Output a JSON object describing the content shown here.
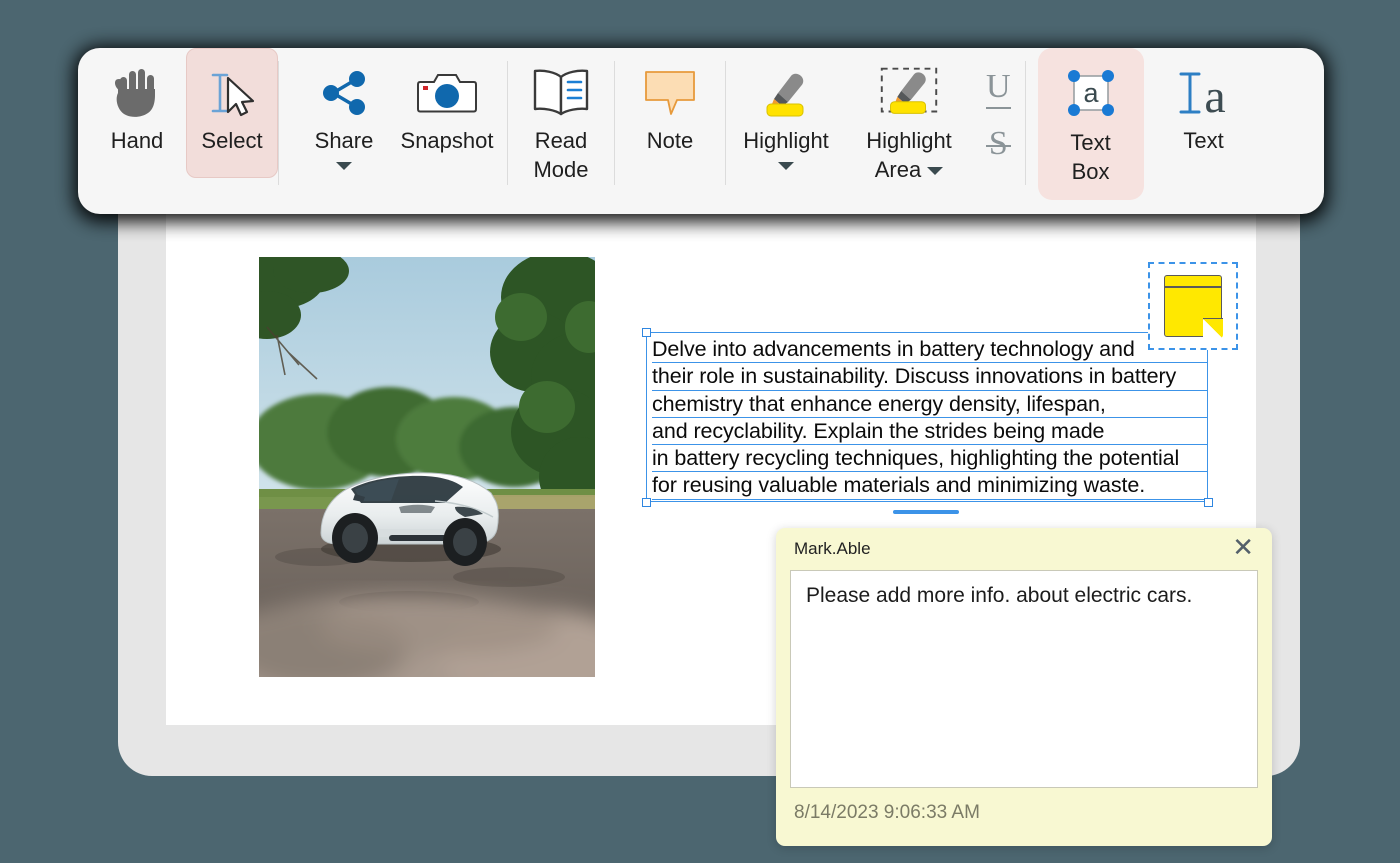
{
  "theme": {
    "background": "#4c6670",
    "window_frame": "#e6e6e6",
    "page": "#ffffff",
    "toolbar_bg": "#f6f6f6",
    "active_tool_bg": "#f2ddda",
    "accent_blue": "#3c93e8",
    "note_yellow": "#f8f8d2",
    "sticky_yellow": "#ffe800",
    "highlight_yellow": "#ffe200"
  },
  "toolbar": {
    "items": [
      {
        "id": "hand",
        "label": "Hand",
        "icon": "hand-icon",
        "active": false,
        "caret": false
      },
      {
        "id": "select",
        "label": "Select",
        "icon": "select-cursor-icon",
        "active": true,
        "caret": false
      },
      {
        "id": "share",
        "label": "Share",
        "icon": "share-icon",
        "active": false,
        "caret": true
      },
      {
        "id": "snapshot",
        "label": "Snapshot",
        "icon": "camera-icon",
        "active": false,
        "caret": false
      },
      {
        "id": "readmode",
        "label": "Read\nMode",
        "icon": "open-book-icon",
        "active": false,
        "caret": false
      },
      {
        "id": "note",
        "label": "Note",
        "icon": "speech-bubble-icon",
        "active": false,
        "caret": false
      },
      {
        "id": "highlight",
        "label": "Highlight",
        "icon": "highlighter-icon",
        "active": false,
        "caret": true
      },
      {
        "id": "higharea",
        "label": "Highlight\nArea",
        "icon": "highlight-area-icon",
        "active": false,
        "caret": true
      },
      {
        "id": "textbox",
        "label": "Text\nBox",
        "icon": "text-box-icon",
        "active": true,
        "caret": false
      },
      {
        "id": "text",
        "label": "Text",
        "icon": "text-cursor-icon",
        "active": false,
        "caret": false
      }
    ],
    "underline_glyph": "U",
    "strikethrough_glyph": "S"
  },
  "document": {
    "image_alt": "white electric car parked on gravel road with green trees",
    "textbox": {
      "selected": true,
      "lines": [
        "Delve into advancements in battery technology and",
        "their role in sustainability. Discuss innovations in battery",
        "chemistry that enhance energy density, lifespan,",
        "and recyclability. Explain the strides being made",
        "in battery recycling techniques, highlighting the potential",
        "for reusing valuable materials and minimizing waste."
      ]
    },
    "sticky_note_icon": {
      "selected": true
    }
  },
  "note_popup": {
    "author": "Mark.Able",
    "close_glyph": "✕",
    "body_text": "Please add more info. about electric cars.",
    "timestamp": "8/14/2023 9:06:33 AM"
  }
}
